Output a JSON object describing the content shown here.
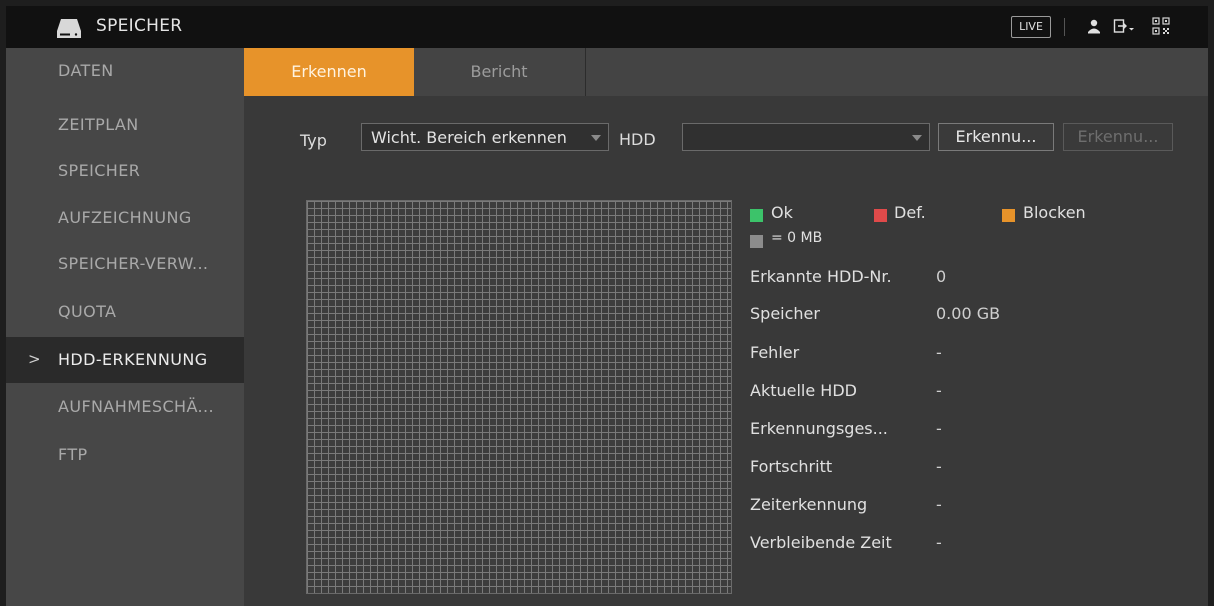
{
  "header": {
    "title": "SPEICHER",
    "live_label": "LIVE",
    "icons": [
      "hdd-icon",
      "user-icon",
      "exit-icon",
      "qr-code-icon"
    ]
  },
  "sidebar": {
    "items": [
      {
        "label": "DATEN"
      },
      {
        "label": "ZEITPLAN"
      },
      {
        "label": "SPEICHER"
      },
      {
        "label": "AUFZEICHNUNG"
      },
      {
        "label": "SPEICHER-VERW..."
      },
      {
        "label": "QUOTA"
      },
      {
        "label": "HDD-ERKENNUNG",
        "active": true
      },
      {
        "label": "AUFNAHMESCHÄ..."
      },
      {
        "label": "FTP"
      }
    ],
    "active_marker": ">"
  },
  "tabs": [
    {
      "label": "Erkennen",
      "active": true
    },
    {
      "label": "Bericht"
    }
  ],
  "controls": {
    "type_label": "Typ",
    "type_value": "Wicht. Bereich erkennen",
    "hdd_label": "HDD",
    "hdd_value": "",
    "detect_button": "Erkennu...",
    "detect_button_2": "Erkennu..."
  },
  "legend": {
    "ok": "Ok",
    "def": "Def.",
    "block": "Blocken",
    "unit": "= 0 MB",
    "colors": {
      "ok": "#3cc36a",
      "def": "#e04a4a",
      "block": "#e7932a",
      "unit": "#8c8c8c"
    }
  },
  "info": [
    {
      "label": "Erkannte HDD-Nr.",
      "value": "0"
    },
    {
      "label": "Speicher",
      "value": "0.00 GB"
    },
    {
      "label": "Fehler",
      "value": "-"
    },
    {
      "label": "Aktuelle HDD",
      "value": "-"
    },
    {
      "label": "Erkennungsges...",
      "value": "-"
    },
    {
      "label": "Fortschritt",
      "value": "-"
    },
    {
      "label": "Zeiterkennung",
      "value": "-"
    },
    {
      "label": "Verbleibende Zeit",
      "value": "-"
    }
  ],
  "accent_color": "#e7932a"
}
